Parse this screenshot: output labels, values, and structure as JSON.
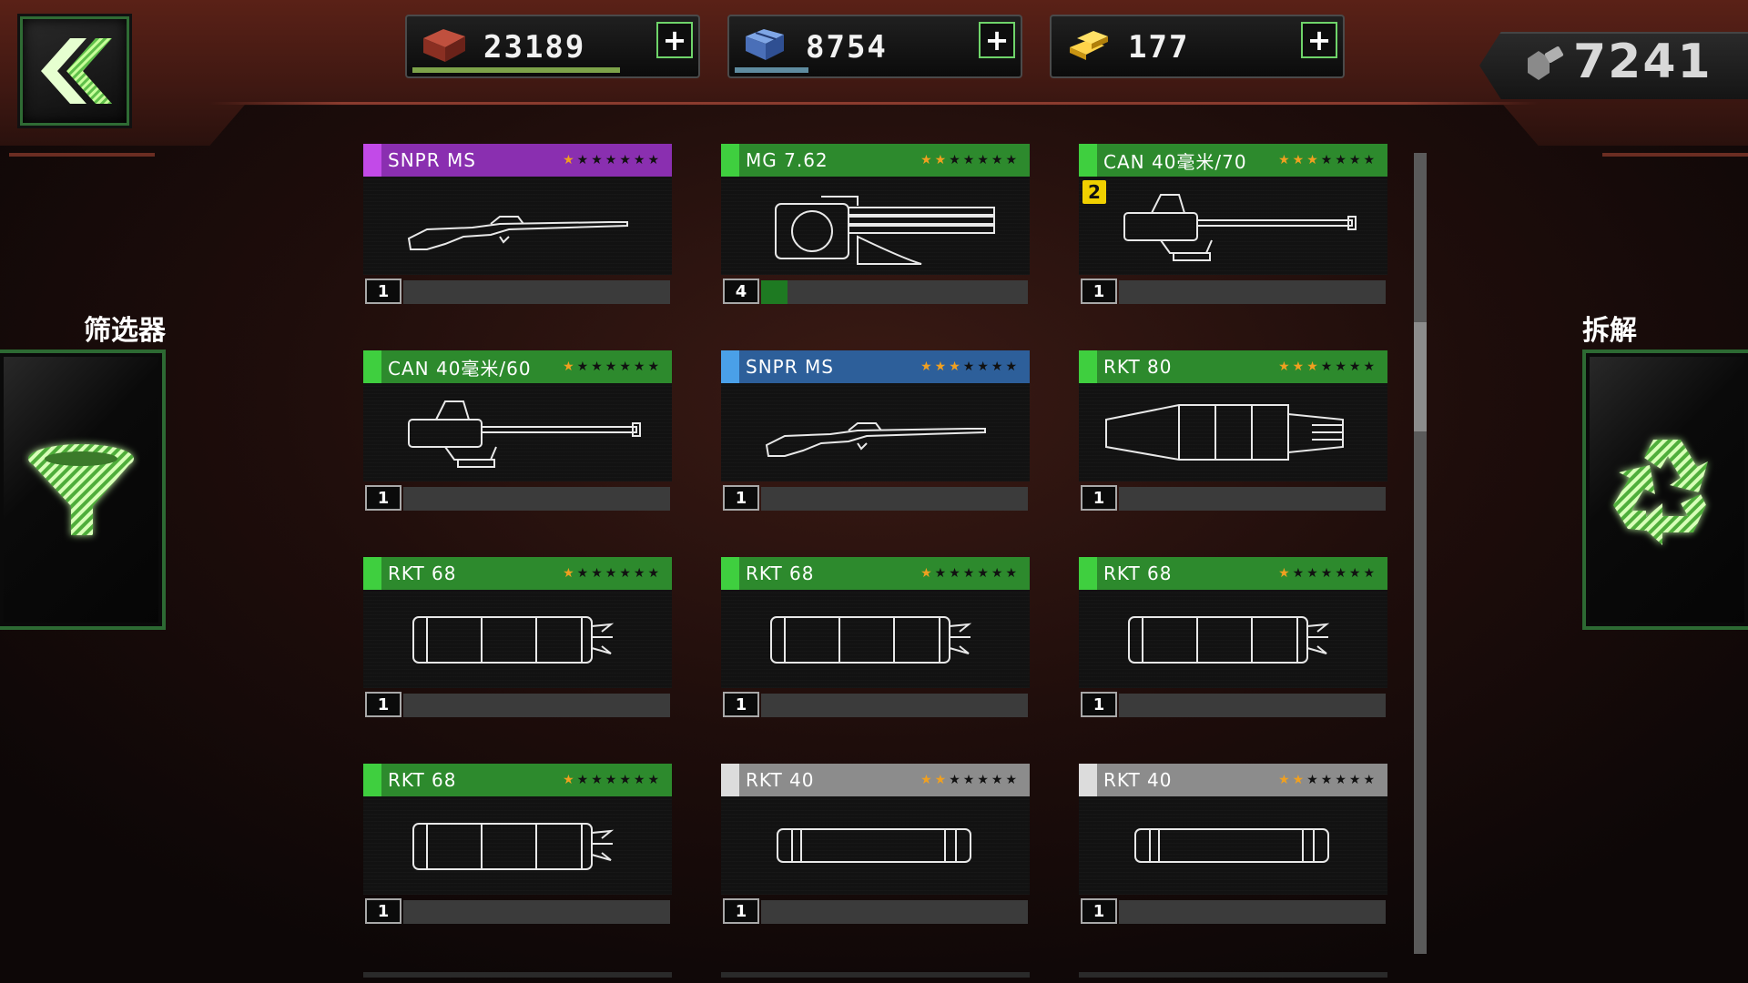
{
  "header": {
    "currencies": [
      {
        "name": "cash-red",
        "value": "23189",
        "bar_color": "#7da34a",
        "bar_fraction": 0.73
      },
      {
        "name": "steel-blue",
        "value": "8754",
        "bar_color": "#5f8ca0",
        "bar_fraction": 0.26
      },
      {
        "name": "gold",
        "value": "177",
        "bar_color": "#7b7b7b",
        "bar_fraction": 0.0
      }
    ],
    "plus_label": "+",
    "score": "7241"
  },
  "sidebar": {
    "filter_label": "筛选器",
    "dismantle_label": "拆解"
  },
  "colors": {
    "purple": "#8a2fb0",
    "green": "#2d8a2d",
    "blue": "#2d5f9a",
    "grey": "#8c8c8c",
    "star_on": "#f0a020",
    "star_off": "#111111"
  },
  "items": [
    {
      "title": "SNPR MS",
      "rarity": "purple",
      "stars_filled": 1,
      "stars_total": 7,
      "quantity": "1",
      "progress": 0.0,
      "weapon": "sniper-rifle"
    },
    {
      "title": "MG 7.62",
      "rarity": "green",
      "stars_filled": 2,
      "stars_total": 7,
      "quantity": "4",
      "progress": 0.1,
      "weapon": "gatling-gun"
    },
    {
      "title": "CAN 40毫米/70",
      "rarity": "green",
      "stars_filled": 3,
      "stars_total": 7,
      "quantity": "1",
      "progress": 0.0,
      "weapon": "cannon",
      "badge": "2"
    },
    {
      "title": "CAN 40毫米/60",
      "rarity": "green",
      "stars_filled": 1,
      "stars_total": 7,
      "quantity": "1",
      "progress": 0.0,
      "weapon": "cannon"
    },
    {
      "title": "SNPR MS",
      "rarity": "blue",
      "stars_filled": 3,
      "stars_total": 7,
      "quantity": "1",
      "progress": 0.0,
      "weapon": "sniper-rifle"
    },
    {
      "title": "RKT 80",
      "rarity": "green",
      "stars_filled": 3,
      "stars_total": 7,
      "quantity": "1",
      "progress": 0.0,
      "weapon": "rocket-pod-large"
    },
    {
      "title": "RKT 68",
      "rarity": "green",
      "stars_filled": 1,
      "stars_total": 7,
      "quantity": "1",
      "progress": 0.0,
      "weapon": "rocket-pod"
    },
    {
      "title": "RKT 68",
      "rarity": "green",
      "stars_filled": 1,
      "stars_total": 7,
      "quantity": "1",
      "progress": 0.0,
      "weapon": "rocket-pod"
    },
    {
      "title": "RKT 68",
      "rarity": "green",
      "stars_filled": 1,
      "stars_total": 7,
      "quantity": "1",
      "progress": 0.0,
      "weapon": "rocket-pod"
    },
    {
      "title": "RKT 68",
      "rarity": "green",
      "stars_filled": 1,
      "stars_total": 7,
      "quantity": "1",
      "progress": 0.0,
      "weapon": "rocket-pod"
    },
    {
      "title": "RKT 40",
      "rarity": "grey",
      "stars_filled": 2,
      "stars_total": 7,
      "quantity": "1",
      "progress": 0.0,
      "weapon": "rocket-tube"
    },
    {
      "title": "RKT 40",
      "rarity": "grey",
      "stars_filled": 2,
      "stars_total": 7,
      "quantity": "1",
      "progress": 0.0,
      "weapon": "rocket-tube"
    }
  ]
}
